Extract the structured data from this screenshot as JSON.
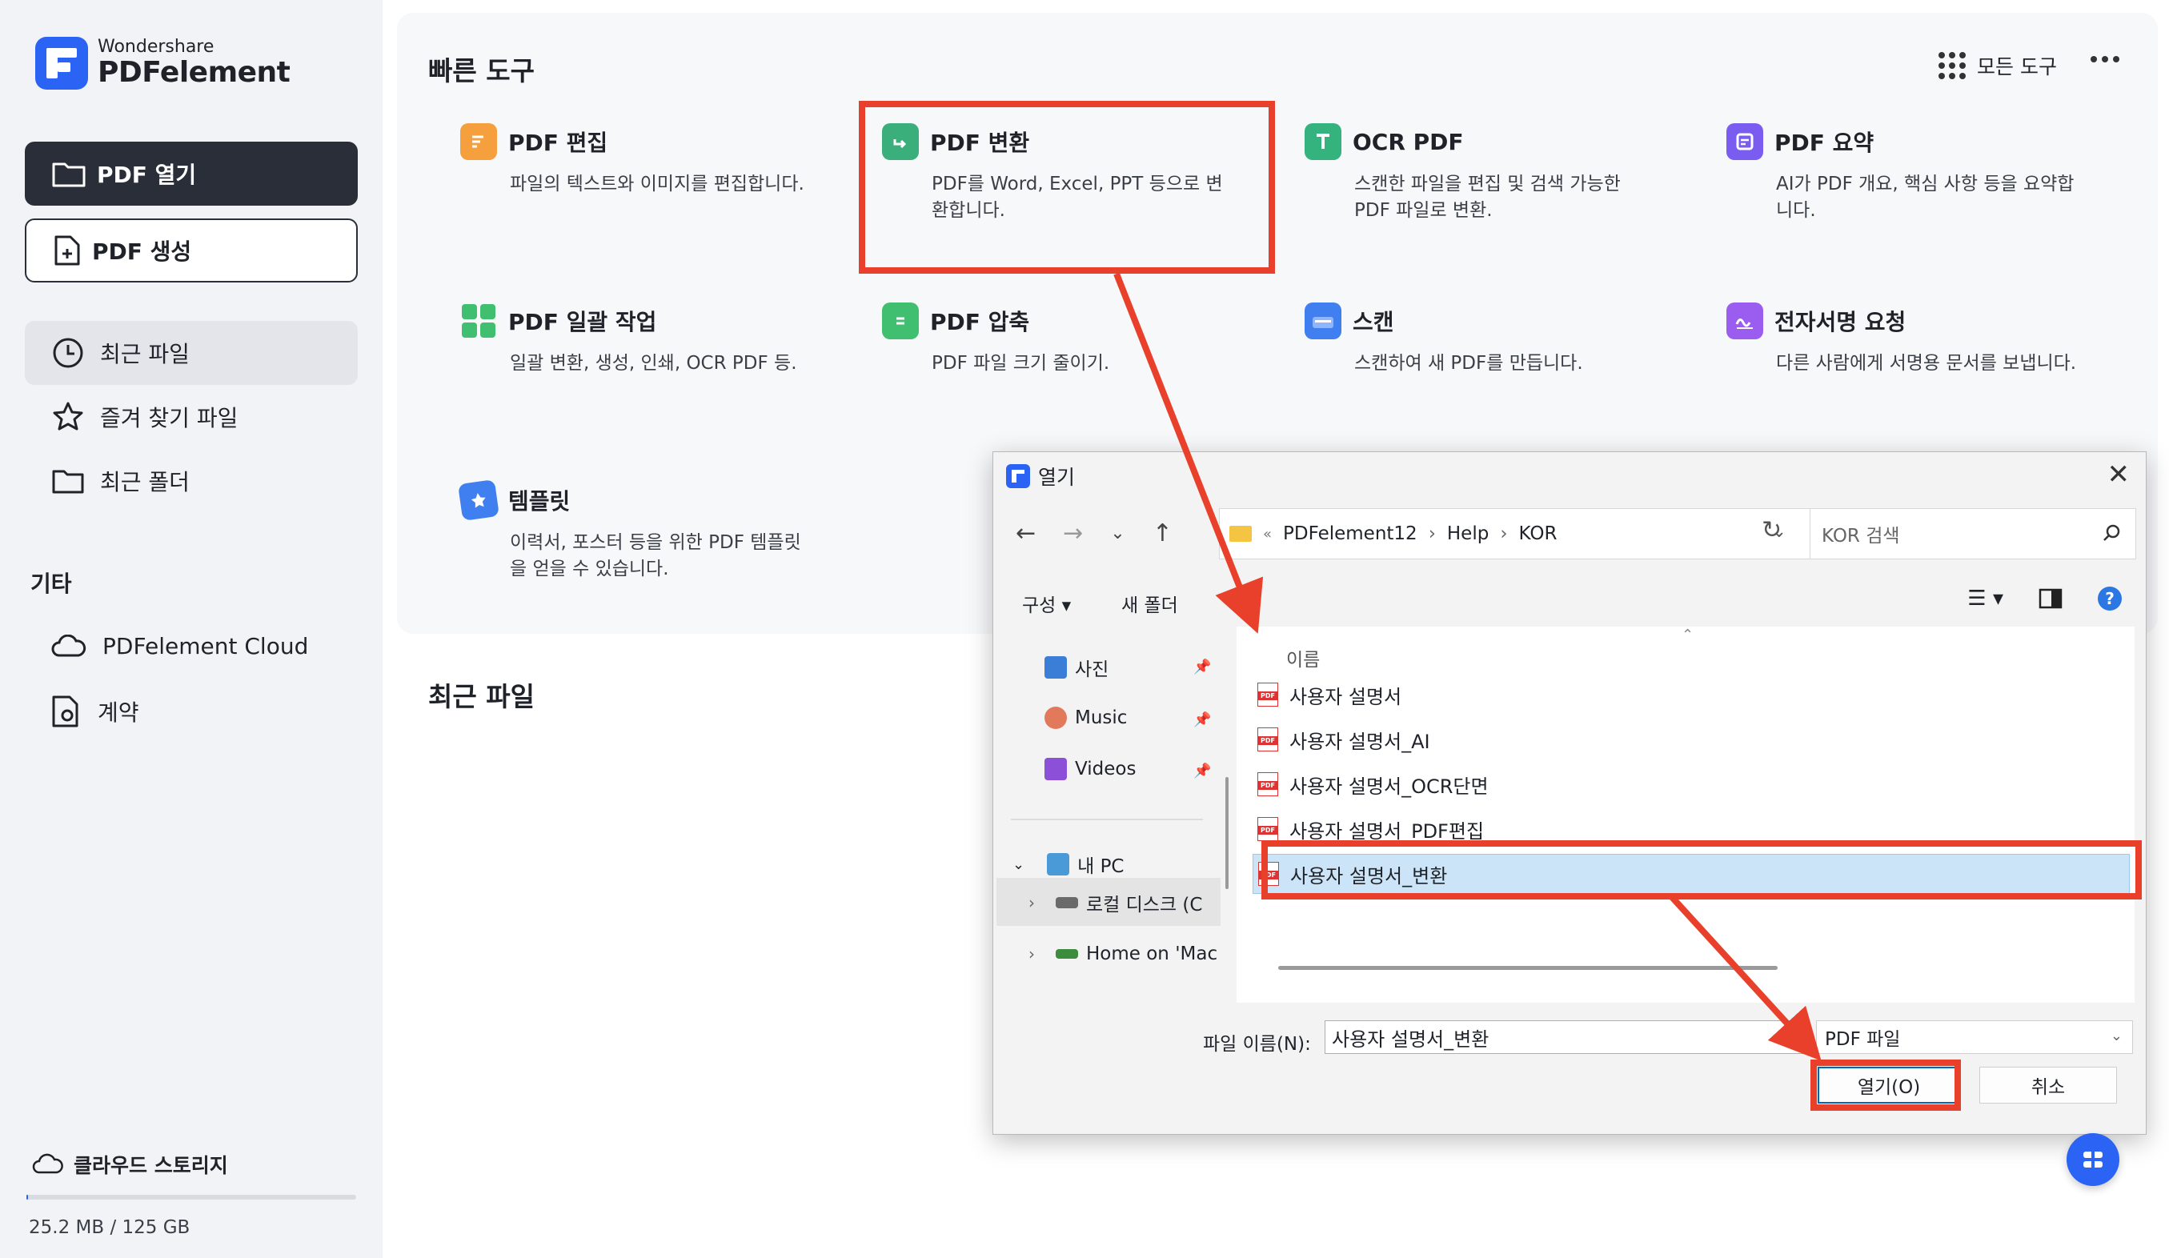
{
  "app": {
    "brand_small": "Wondershare",
    "brand_big": "PDFelement"
  },
  "sidebar": {
    "open_pdf": "PDF 열기",
    "create_pdf": "PDF 생성",
    "items": [
      {
        "label": "최근 파일",
        "icon": "clock-icon"
      },
      {
        "label": "즐겨 찾기 파일",
        "icon": "star-icon"
      },
      {
        "label": "최근 폴더",
        "icon": "folder-icon"
      }
    ],
    "section_other": "기타",
    "other_items": [
      {
        "label": "PDFelement Cloud",
        "icon": "cloud-icon"
      },
      {
        "label": "계약",
        "icon": "contract-icon"
      }
    ],
    "storage_label": "클라우드 스토리지",
    "storage_used": "25.2 MB / 125 GB",
    "storage_fraction": 0.0002
  },
  "main": {
    "quick_tools_title": "빠른 도구",
    "all_tools": "모든 도구",
    "recent_files_title": "최근 파일",
    "tools": [
      {
        "title": "PDF 편집",
        "desc": "파일의 텍스트와 이미지를 편집합니다.",
        "color": "#f5a03d"
      },
      {
        "title": "PDF 변환",
        "desc": "PDF를 Word, Excel, PPT 등으로 변환합니다.",
        "color": "#3aaf7c"
      },
      {
        "title": "OCR PDF",
        "desc": "스캔한 파일을 편집 및 검색 가능한 PDF 파일로 변환.",
        "color": "#35b37e"
      },
      {
        "title": "PDF 요약",
        "desc": "AI가 PDF 개요, 핵심 사항 등을 요약합니다.",
        "color": "#7a5cf0"
      },
      {
        "title": "PDF 일괄 작업",
        "desc": "일괄 변환, 생성, 인쇄, OCR PDF 등.",
        "color": "#3fbf6f"
      },
      {
        "title": "PDF 압축",
        "desc": "PDF 파일 크기 줄이기.",
        "color": "#3fbf6f"
      },
      {
        "title": "스캔",
        "desc": "스캔하여 새 PDF를 만듭니다.",
        "color": "#3f7ff0"
      },
      {
        "title": "전자서명 요청",
        "desc": "다른 사람에게 서명용 문서를 보냅니다.",
        "color": "#9b5cf0"
      },
      {
        "title": "템플릿",
        "desc": "이력서, 포스터 등을 위한 PDF 템플릿을 얻을 수 있습니다.",
        "color": "#3f7ff0"
      }
    ]
  },
  "dialog": {
    "title": "열기",
    "path": [
      "PDFelement12",
      "Help",
      "KOR"
    ],
    "path_prefix": "«",
    "search_placeholder": "KOR 검색",
    "organize": "구성 ▾",
    "new_folder": "새 폴더",
    "column_name": "이름",
    "left_items": [
      {
        "label": "사진",
        "icon": "photos-icon"
      },
      {
        "label": "Music",
        "icon": "music-icon"
      },
      {
        "label": "Videos",
        "icon": "videos-icon"
      },
      {
        "label": "내 PC",
        "icon": "pc-icon"
      },
      {
        "label": "로컬 디스크 (C",
        "icon": "disk-icon"
      },
      {
        "label": "Home on 'Mac",
        "icon": "network-drive-icon"
      }
    ],
    "files": [
      "사용자 설명서",
      "사용자 설명서_AI",
      "사용자 설명서_OCR단면",
      "사용자 설명서_PDF편집",
      "사용자 설명서_변환"
    ],
    "selected_index": 4,
    "file_name_label": "파일 이름(N):",
    "file_name_value": "사용자 설명서_변환",
    "file_type": "PDF 파일",
    "open_button": "열기(O)",
    "cancel_button": "취소"
  },
  "colors": {
    "accent": "#2b63f4",
    "highlight": "#e8402a",
    "dark_button": "#2a2e39"
  }
}
